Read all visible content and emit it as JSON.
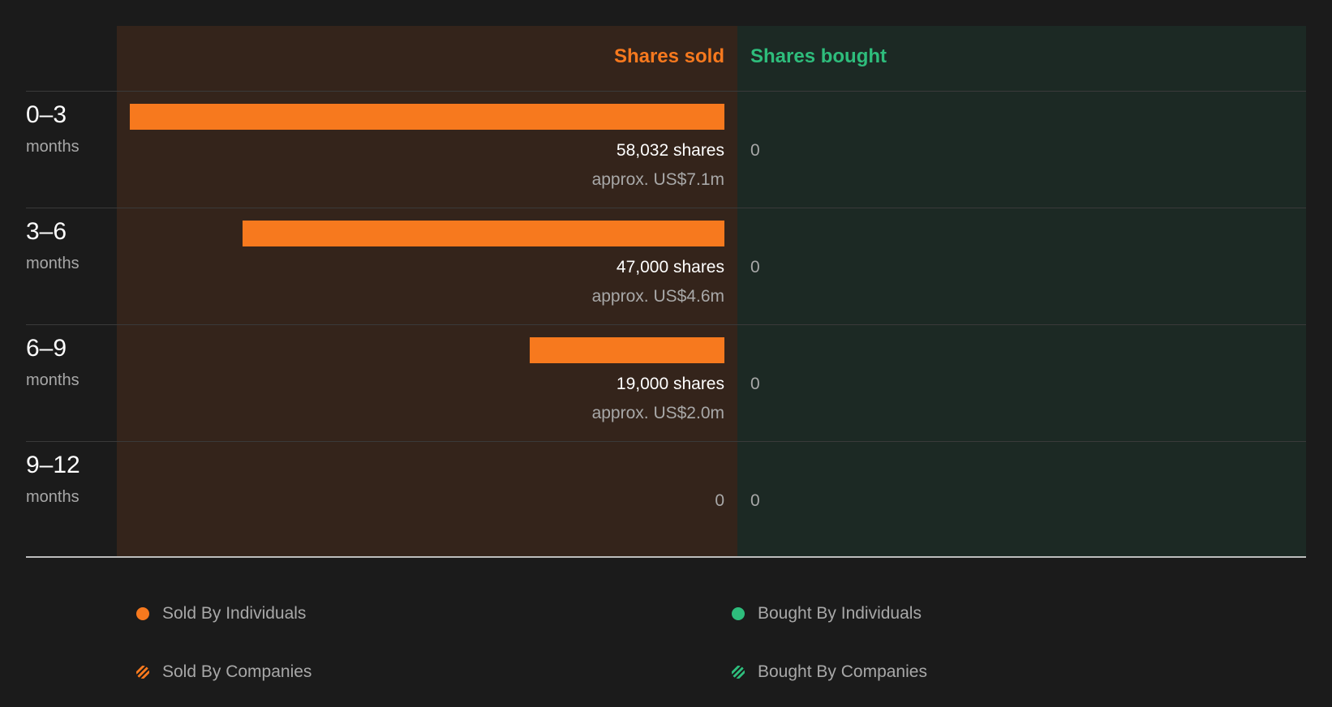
{
  "chart_data": {
    "type": "bar",
    "orientation": "horizontal-diverging",
    "columns": {
      "sold_title": "Shares sold",
      "bought_title": "Shares bought"
    },
    "unit_label": "months",
    "categories": [
      "0–3",
      "3–6",
      "6–9",
      "9–12"
    ],
    "series": [
      {
        "values": [
          58032,
          47000,
          19000,
          0
        ],
        "labels": [
          "58,032 shares",
          "47,000 shares",
          "19,000 shares",
          "0"
        ],
        "approx": [
          "approx. US$7.1m",
          "approx. US$4.6m",
          "approx. US$2.0m",
          ""
        ]
      },
      {
        "values": [
          0,
          0,
          0,
          0
        ],
        "labels": [
          "0",
          "0",
          "0",
          "0"
        ]
      }
    ],
    "legend": [
      {
        "label": "Sold By Individuals",
        "style": "solid",
        "color": "#f7791e"
      },
      {
        "label": "Bought By Individuals",
        "style": "solid",
        "color": "#2ebd7c"
      },
      {
        "label": "Sold By Companies",
        "style": "hatched",
        "color": "#f7791e"
      },
      {
        "label": "Bought By Companies",
        "style": "hatched",
        "color": "#2ebd7c"
      }
    ],
    "colors": {
      "sold": "#f7791e",
      "bought": "#2ebd7c"
    }
  }
}
